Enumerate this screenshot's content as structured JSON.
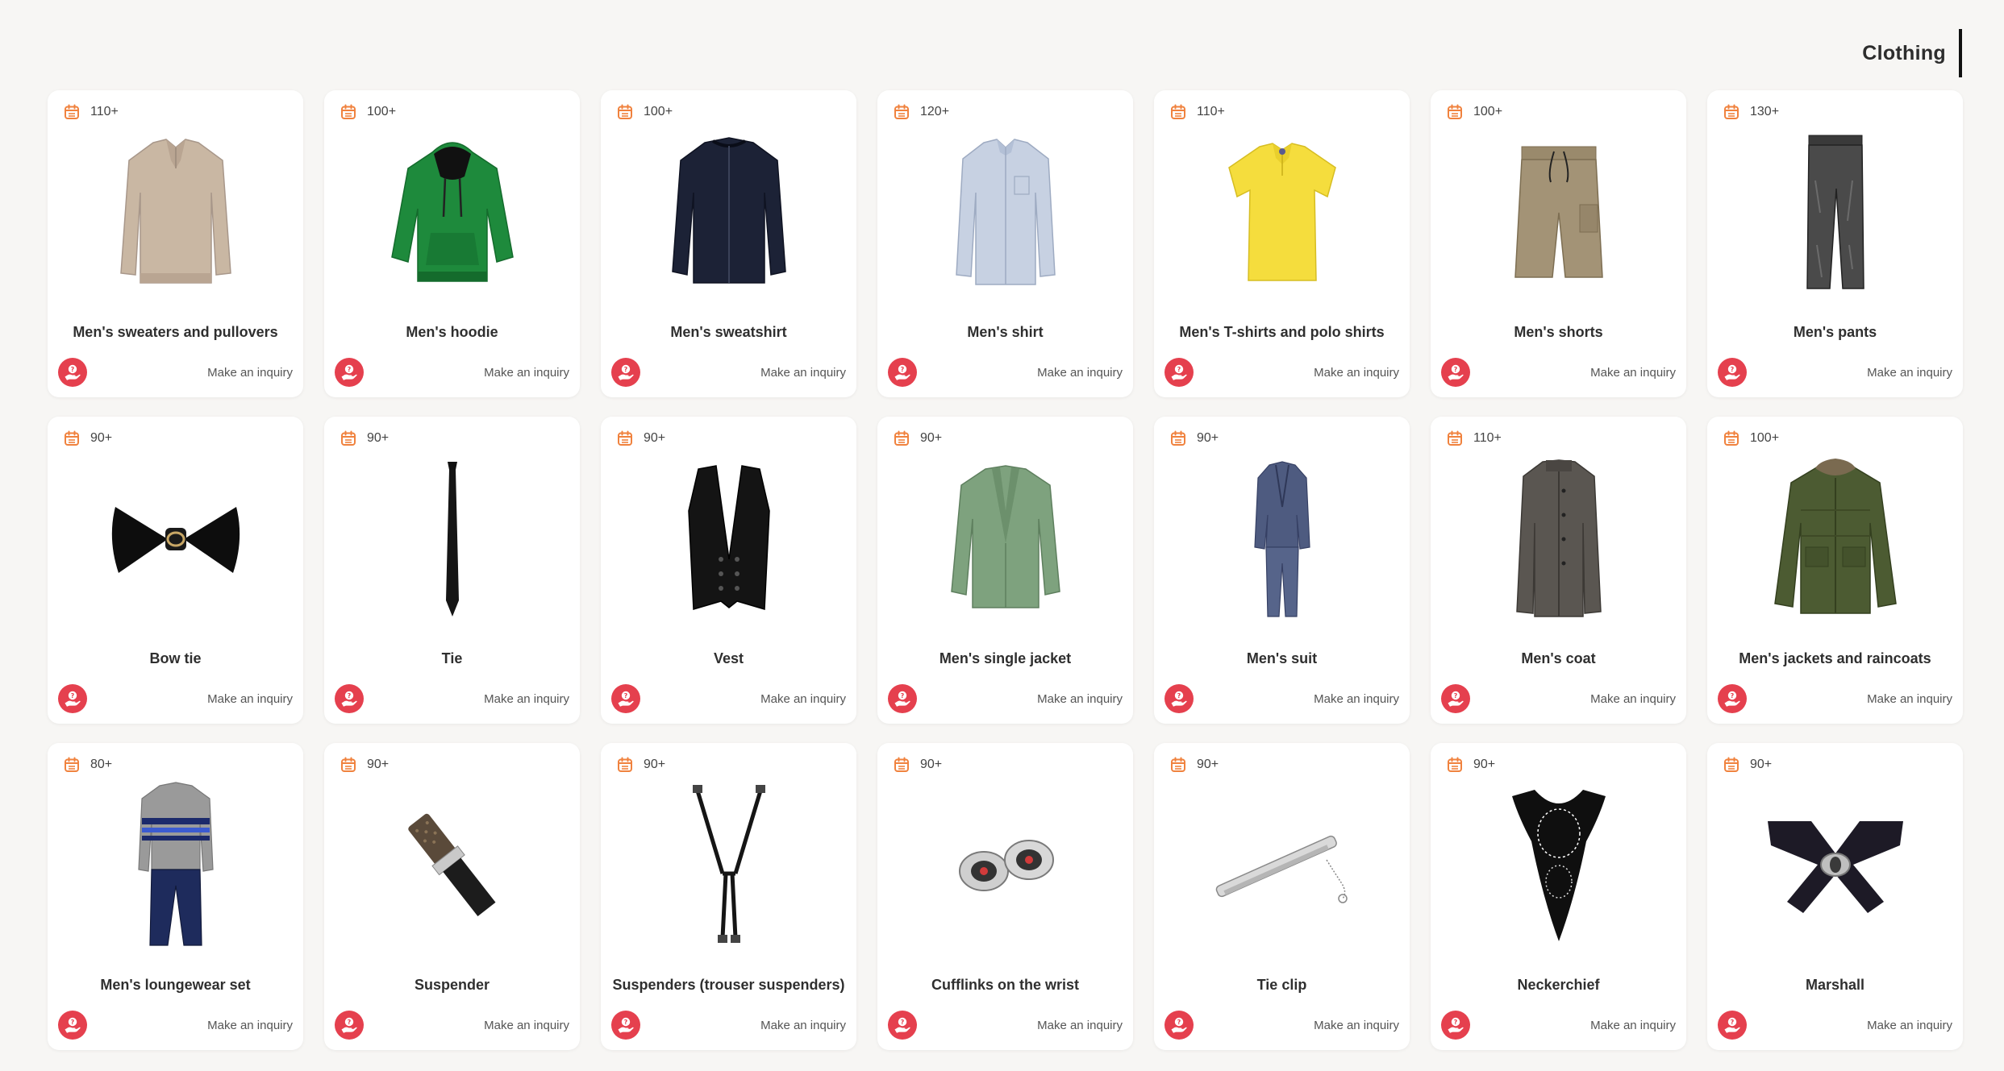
{
  "header": {
    "title": "Clothing"
  },
  "icons": {
    "count": "calendar-icon",
    "inquiry": "hand-question-icon"
  },
  "colors": {
    "accent_red": "#e5404e",
    "count_icon_orange": "#f0823e"
  },
  "cards": [
    {
      "count": "110+",
      "name": "Men's sweaters and pullovers",
      "inquiry": "Make an inquiry",
      "img": "sweater"
    },
    {
      "count": "100+",
      "name": "Men's hoodie",
      "inquiry": "Make an inquiry",
      "img": "hoodie"
    },
    {
      "count": "100+",
      "name": "Men's sweatshirt",
      "inquiry": "Make an inquiry",
      "img": "sweatshirt"
    },
    {
      "count": "120+",
      "name": "Men's shirt",
      "inquiry": "Make an inquiry",
      "img": "shirt"
    },
    {
      "count": "110+",
      "name": "Men's T-shirts and polo shirts",
      "inquiry": "Make an inquiry",
      "img": "polo"
    },
    {
      "count": "100+",
      "name": "Men's shorts",
      "inquiry": "Make an inquiry",
      "img": "shorts"
    },
    {
      "count": "130+",
      "name": "Men's pants",
      "inquiry": "Make an inquiry",
      "img": "pants"
    },
    {
      "count": "90+",
      "name": "Bow tie",
      "inquiry": "Make an inquiry",
      "img": "bowtie"
    },
    {
      "count": "90+",
      "name": "Tie",
      "inquiry": "Make an inquiry",
      "img": "tie"
    },
    {
      "count": "90+",
      "name": "Vest",
      "inquiry": "Make an inquiry",
      "img": "vest"
    },
    {
      "count": "90+",
      "name": "Men's single jacket",
      "inquiry": "Make an inquiry",
      "img": "jacket"
    },
    {
      "count": "90+",
      "name": "Men's suit",
      "inquiry": "Make an inquiry",
      "img": "suit"
    },
    {
      "count": "110+",
      "name": "Men's coat",
      "inquiry": "Make an inquiry",
      "img": "coat"
    },
    {
      "count": "100+",
      "name": "Men's jackets and raincoats",
      "inquiry": "Make an inquiry",
      "img": "parka"
    },
    {
      "count": "80+",
      "name": "Men's loungewear set",
      "inquiry": "Make an inquiry",
      "img": "lounge"
    },
    {
      "count": "90+",
      "name": "Suspender",
      "inquiry": "Make an inquiry",
      "img": "suspender"
    },
    {
      "count": "90+",
      "name": "Suspenders (trouser suspenders)",
      "inquiry": "Make an inquiry",
      "img": "suspenders"
    },
    {
      "count": "90+",
      "name": "Cufflinks on the wrist",
      "inquiry": "Make an inquiry",
      "img": "cufflinks"
    },
    {
      "count": "90+",
      "name": "Tie clip",
      "inquiry": "Make an inquiry",
      "img": "tieclip"
    },
    {
      "count": "90+",
      "name": "Neckerchief",
      "inquiry": "Make an inquiry",
      "img": "neckerchief"
    },
    {
      "count": "90+",
      "name": "Marshall",
      "inquiry": "Make an inquiry",
      "img": "marshall"
    }
  ]
}
